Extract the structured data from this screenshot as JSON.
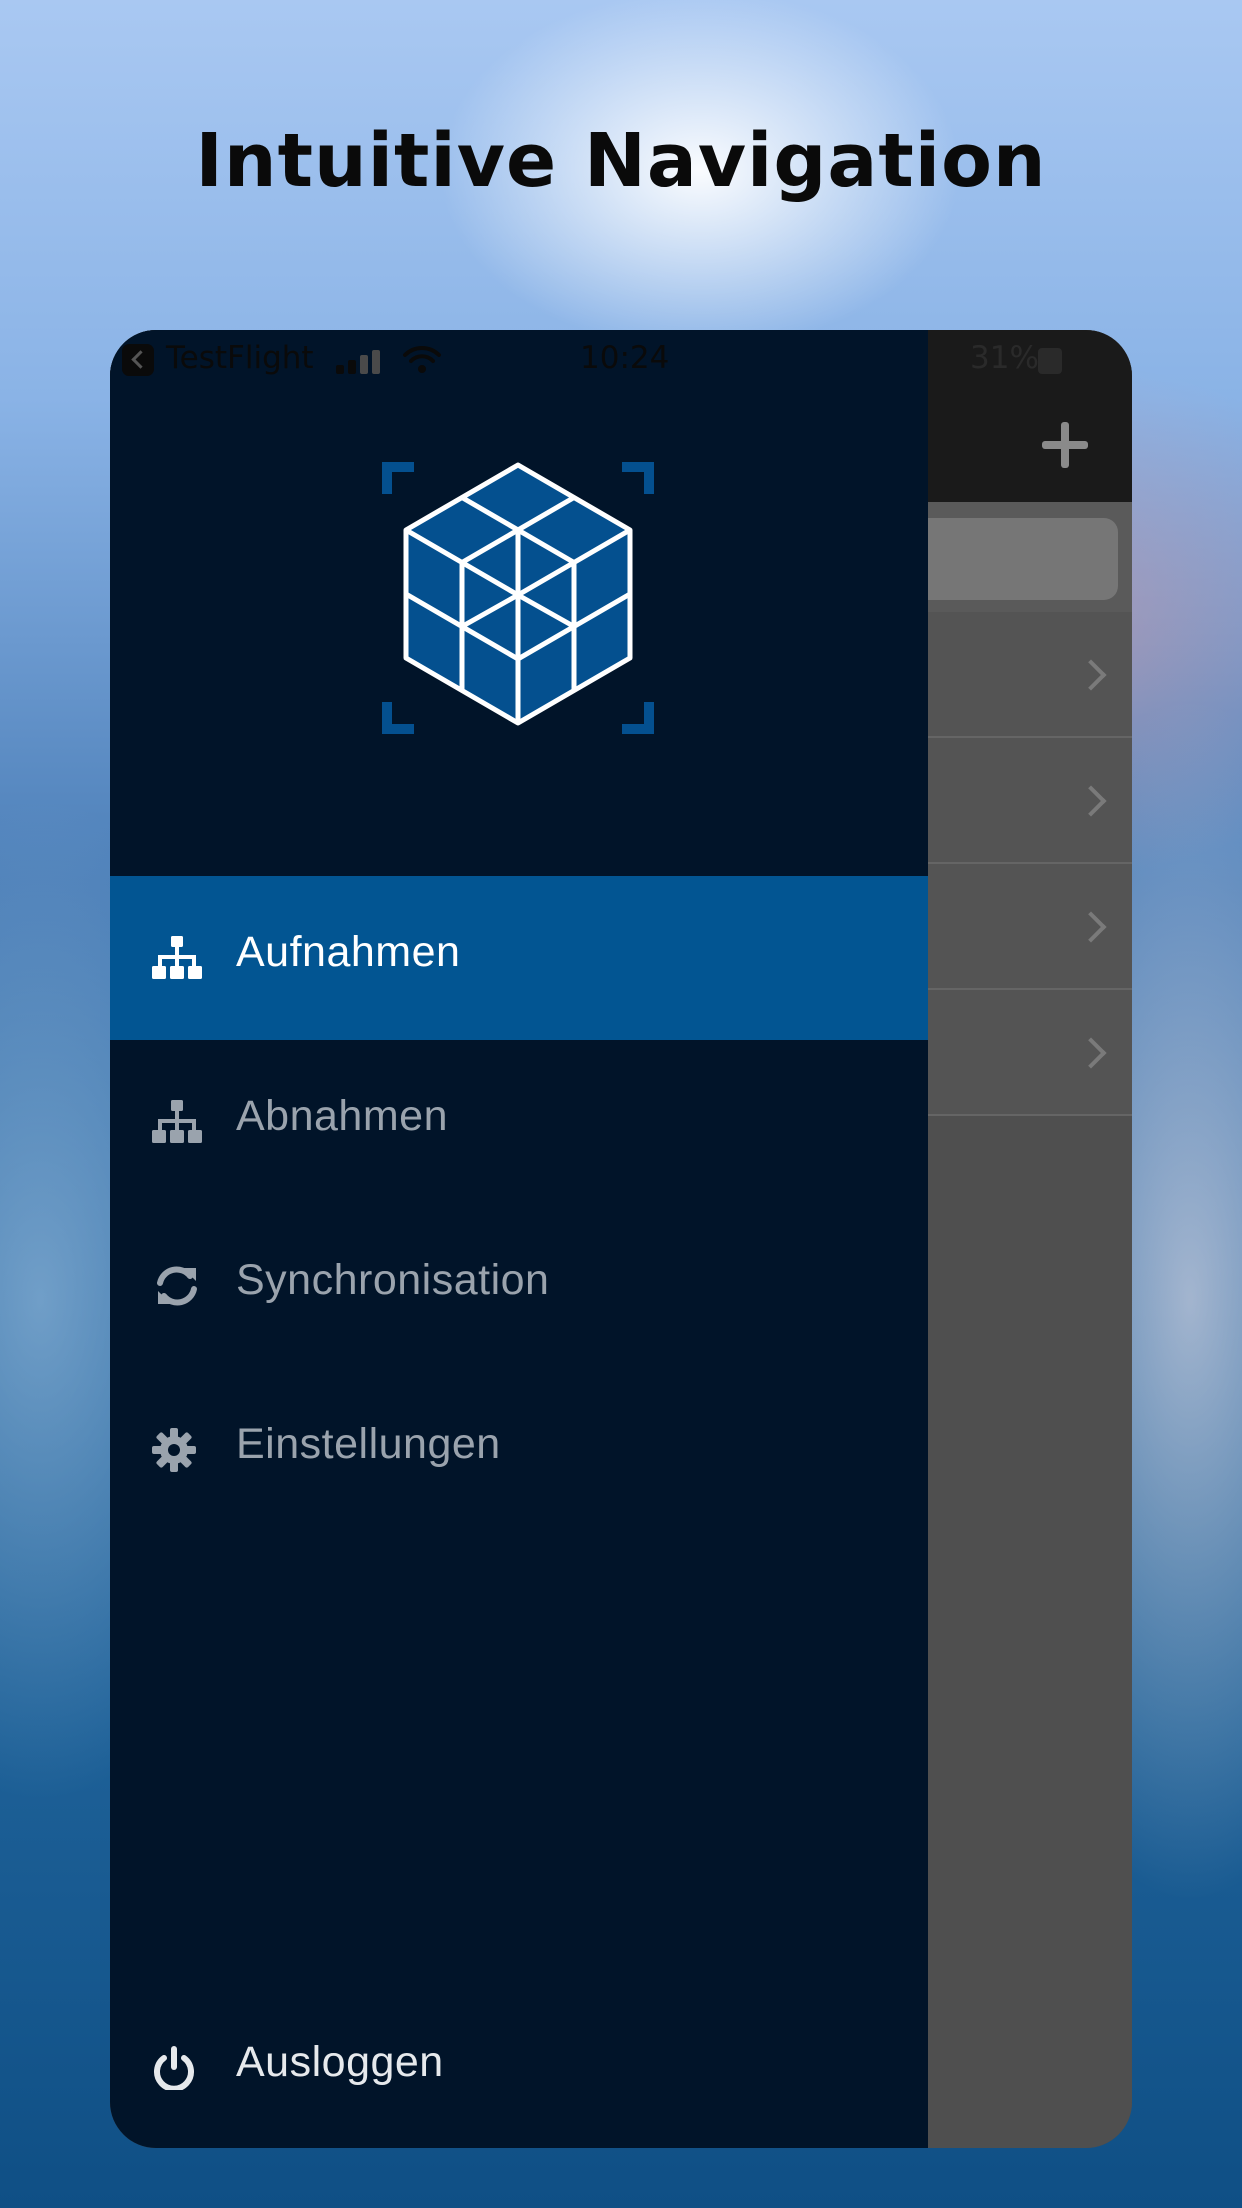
{
  "headline": "Intuitive Navigation",
  "status_bar": {
    "carrier": "TestFlight",
    "time": "10:24",
    "battery": "31%"
  },
  "menu": {
    "items": [
      {
        "label": "Aufnahmen",
        "icon": "sitemap-icon",
        "active": true
      },
      {
        "label": "Abnahmen",
        "icon": "sitemap-icon",
        "active": false
      },
      {
        "label": "Synchronisation",
        "icon": "refresh-icon",
        "active": false
      },
      {
        "label": "Einstellungen",
        "icon": "gear-icon",
        "active": false
      }
    ],
    "logout": {
      "label": "Ausloggen",
      "icon": "power-icon"
    }
  },
  "colors": {
    "drawer_bg": "#011429",
    "active_item_bg": "#025592",
    "logo_blue": "#04508f"
  }
}
